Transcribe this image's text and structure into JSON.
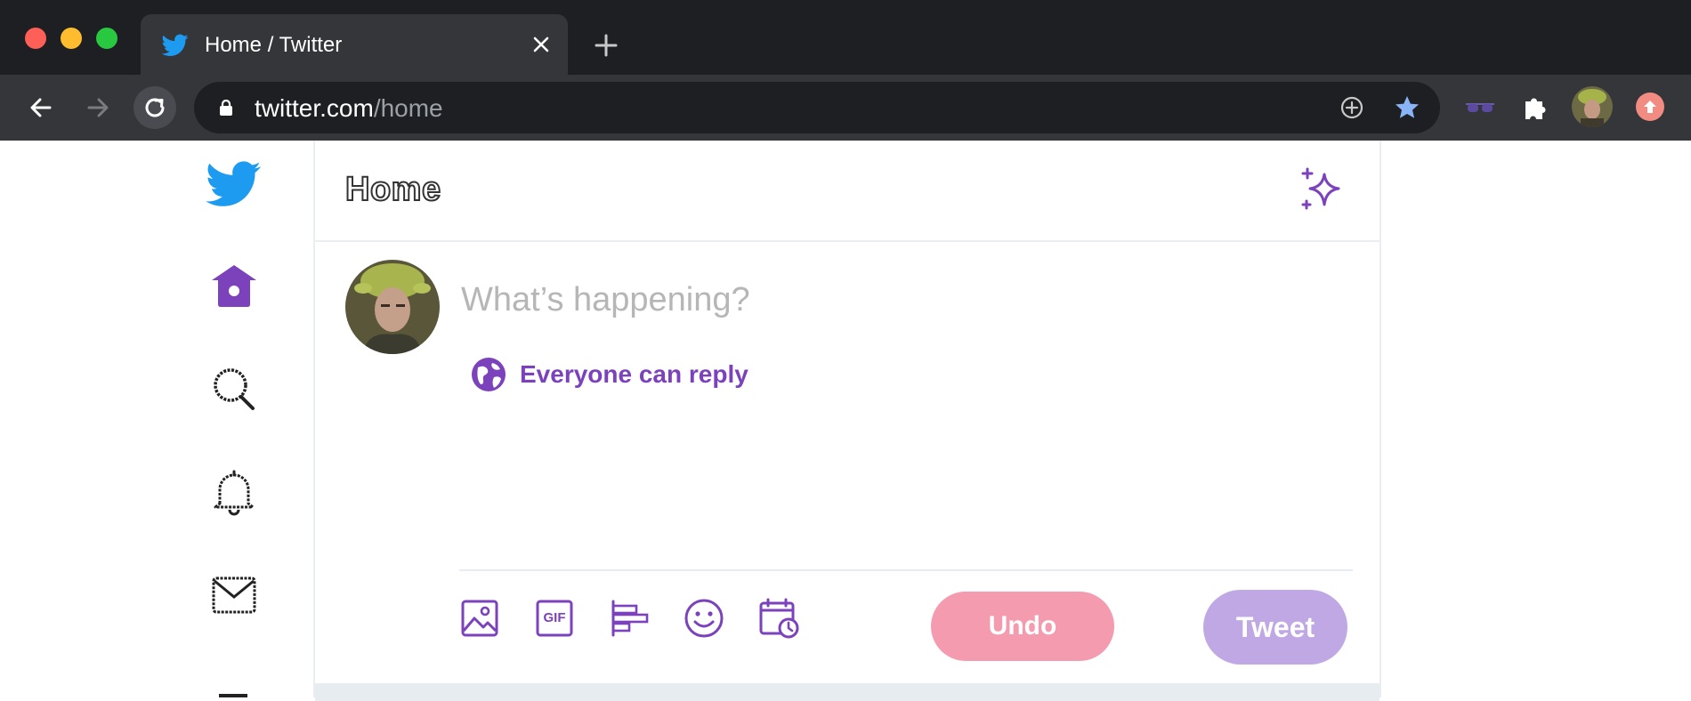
{
  "browser": {
    "tab": {
      "title": "Home / Twitter"
    },
    "address": {
      "domain": "twitter.com",
      "path": "/home"
    },
    "icons": [
      "back-icon",
      "forward-icon",
      "reload-icon",
      "lock-icon",
      "add-icon",
      "star-icon",
      "glasses-extension-icon",
      "puzzle-extension-icon",
      "profile-avatar",
      "update-icon"
    ]
  },
  "sidebar": {
    "items": [
      {
        "name": "twitter-logo",
        "icon": "twitter-bird-icon"
      },
      {
        "name": "home",
        "icon": "home-icon"
      },
      {
        "name": "explore",
        "icon": "search-icon"
      },
      {
        "name": "notifications",
        "icon": "bell-icon"
      },
      {
        "name": "messages",
        "icon": "mail-icon"
      }
    ]
  },
  "header": {
    "title": "Home",
    "icon": "sparkle-icon"
  },
  "composer": {
    "placeholder": "What’s happening?",
    "reply_setting": "Everyone can reply",
    "media_buttons": [
      "image-icon",
      "gif-icon",
      "poll-icon",
      "emoji-icon",
      "schedule-icon"
    ],
    "gif_label": "GIF",
    "undo_label": "Undo",
    "tweet_label": "Tweet"
  },
  "colors": {
    "accent": "#7b42bc",
    "twitter_blue": "#1d9bf0",
    "undo_bg": "#f59bb0",
    "tweet_bg": "#c0a8e4"
  }
}
